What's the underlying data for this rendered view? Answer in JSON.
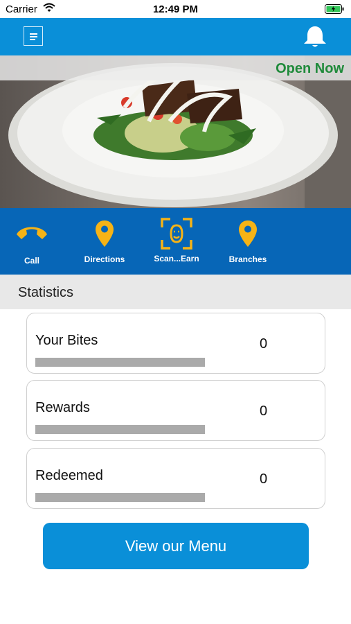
{
  "status_bar": {
    "carrier": "Carrier",
    "time": "12:49 PM",
    "icons": [
      "wifi-icon",
      "battery-charging-icon"
    ]
  },
  "top_bar": {
    "color": "#0a8fd8",
    "icons": [
      "menu-icon",
      "bell-icon"
    ]
  },
  "hero": {
    "open_status": "Open Now",
    "open_status_color": "#1f8a3a",
    "image": "plated-dish-photo"
  },
  "actions": {
    "color": "#0766b7",
    "icon_color": "#f6b316",
    "items": [
      {
        "label": "Call",
        "icon": "phone-icon"
      },
      {
        "label": "Directions",
        "icon": "map-pin-icon"
      },
      {
        "label": "Scan...Earn",
        "icon": "scan-face-icon"
      },
      {
        "label": "Branches",
        "icon": "map-pin-icon"
      }
    ]
  },
  "statistics": {
    "title": "Statistics",
    "cards": [
      {
        "label": "Your Bites",
        "value": "0",
        "progress": 0
      },
      {
        "label": "Rewards",
        "value": "0",
        "progress": 0
      },
      {
        "label": "Redeemed",
        "value": "0",
        "progress": 0
      }
    ]
  },
  "menu_button": {
    "label": "View our Menu"
  }
}
